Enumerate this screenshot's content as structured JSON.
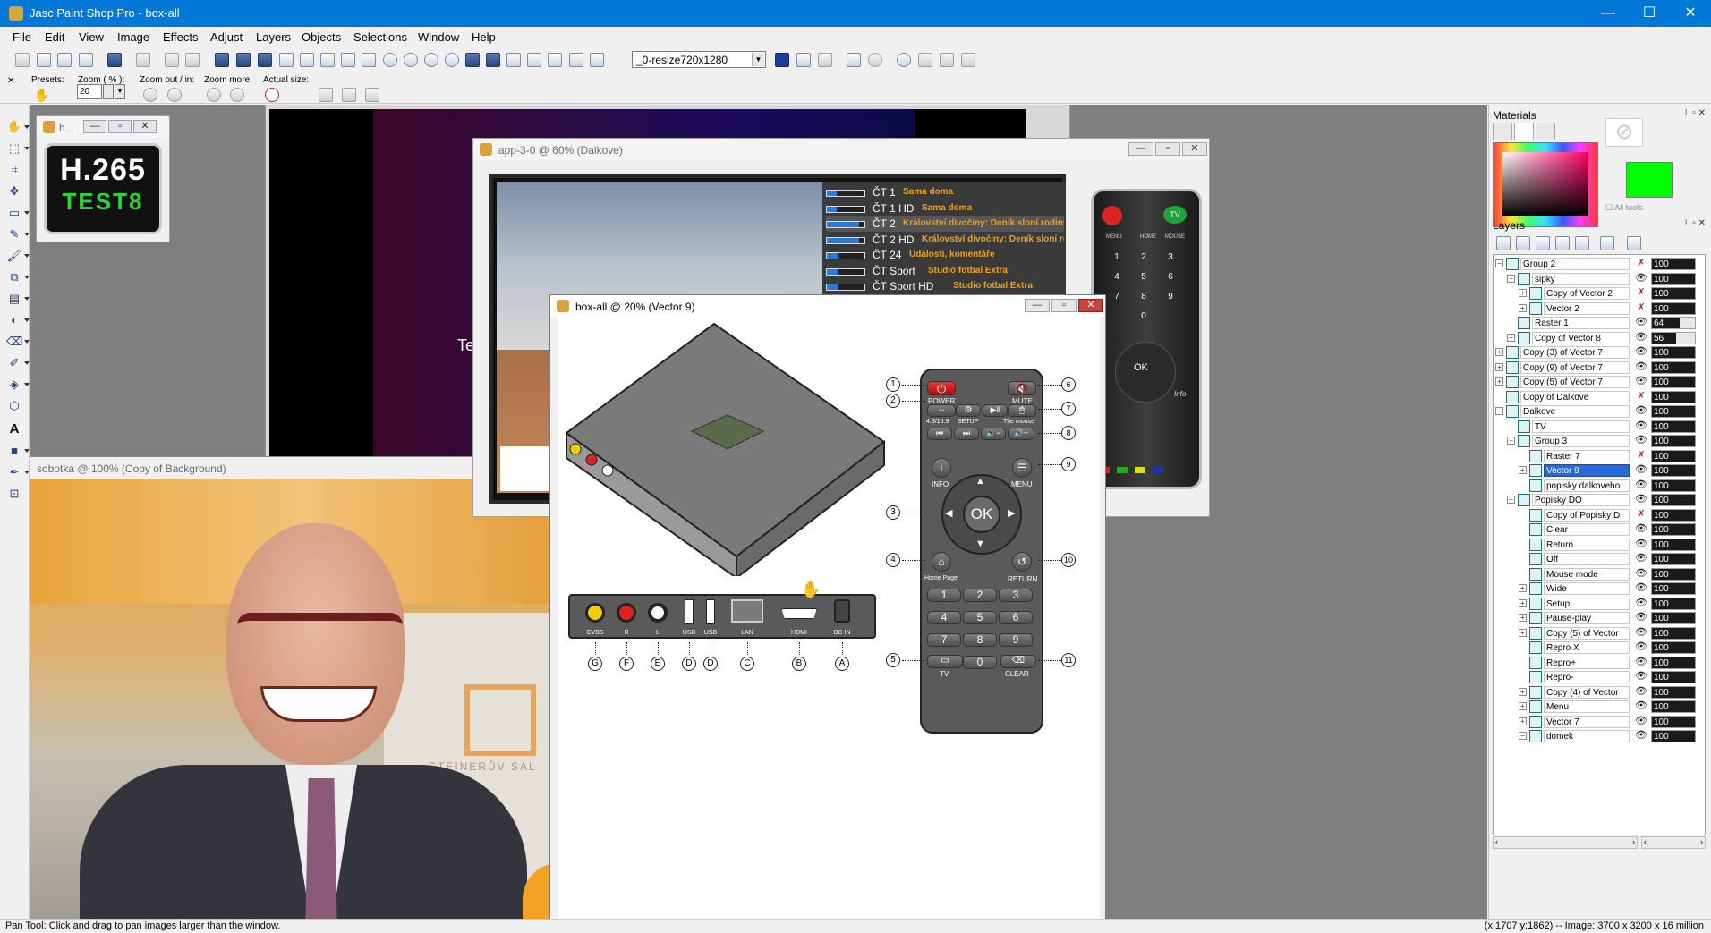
{
  "app": {
    "title": "Jasc Paint Shop Pro - box-all",
    "window_controls": {
      "minimize": "—",
      "maximize": "☐",
      "close": "✕"
    }
  },
  "menu": [
    "File",
    "Edit",
    "View",
    "Image",
    "Effects",
    "Adjust",
    "Layers",
    "Objects",
    "Selections",
    "Window",
    "Help"
  ],
  "toolbar": {
    "script_select": "_0-resize720x1280"
  },
  "tool_options": {
    "presets_label": "Presets:",
    "zoom_label": "Zoom ( % ):",
    "zoom_value": "20",
    "zoom_out_in_label": "Zoom out / in:",
    "zoom_more_label": "Zoom more:",
    "actual_size_label": "Actual size:"
  },
  "documents": {
    "h265": {
      "title": "h...",
      "logo_line1": "H.265",
      "logo_line2": "TEST8"
    },
    "background_doc": {
      "partial_text": "Te"
    },
    "sobotka": {
      "title": "sobotka @ 100% (Copy of Background)",
      "wall_text": "STEINERŮV SÁL"
    },
    "app3": {
      "title": "app-3-0 @  60% (Dalkove)",
      "channels": [
        {
          "name": "ČT 1",
          "show": "Sama doma",
          "progress": 0.25
        },
        {
          "name": "ČT 1 HD",
          "show": "Sama doma",
          "progress": 0.25
        },
        {
          "name": "ČT 2",
          "show": "Království divočiny: Deník sloní rodiny",
          "progress": 0.85
        },
        {
          "name": "ČT 2 HD",
          "show": "Království divočiny: Deník sloní rod",
          "progress": 0.85
        },
        {
          "name": "ČT 24",
          "show": "Události, komentáře",
          "progress": 0.3
        },
        {
          "name": "ČT Sport",
          "show": "Studio fotbal Extra",
          "progress": 0.3
        },
        {
          "name": "ČT Sport  HD",
          "show": "Studio fotbal Extra",
          "progress": 0.3
        }
      ],
      "remote": {
        "tv_label": "TV",
        "menu_label": "MENU",
        "home_label": "HOME",
        "mouse_label": "MOUSE",
        "ok_label": "OK",
        "keys": [
          "1",
          "2",
          "3",
          "4",
          "5",
          "6",
          "7",
          "8",
          "9",
          "0"
        ],
        "brand": "Info"
      }
    },
    "boxall": {
      "title": "box-all @  20% (Vector 9)",
      "remote": {
        "power_label": "POWER",
        "mute_label": "MUTE",
        "aspect_label": "4:3/16:9",
        "setup_label": "SETUP",
        "mouse_label": "The mouse",
        "info_label": "INFO",
        "menu_label": "MENU",
        "ok_label": "OK",
        "home_label": "Home Page",
        "return_label": "RETURN",
        "tv_label": "TV",
        "clear_label": "CLEAR",
        "keys": [
          "1",
          "2",
          "3",
          "4",
          "5",
          "6",
          "7",
          "8",
          "9",
          "0"
        ]
      },
      "callouts_left": [
        "1",
        "2",
        "3",
        "4",
        "5"
      ],
      "callouts_right": [
        "6",
        "7",
        "8",
        "9",
        "10",
        "11"
      ],
      "ports": [
        "CVBS",
        "R",
        "L",
        "USB",
        "USB",
        "LAN",
        "HDMI",
        "DC IN"
      ],
      "port_letters": [
        "G",
        "F",
        "E",
        "D",
        "D",
        "C",
        "B",
        "A"
      ]
    }
  },
  "materials": {
    "title": "Materials",
    "all_tools": "All tools",
    "foreground_color": "#00ff00"
  },
  "layers": {
    "title": "Layers",
    "rows": [
      {
        "name": "Group 2",
        "depth": 0,
        "expander": "−",
        "visible": false,
        "opacity": 100
      },
      {
        "name": "šipky",
        "depth": 1,
        "expander": "−",
        "visible": true,
        "opacity": 100
      },
      {
        "name": "Copy of Vector 2",
        "depth": 2,
        "expander": "+",
        "visible": false,
        "opacity": 100
      },
      {
        "name": "Vector 2",
        "depth": 2,
        "expander": "+",
        "visible": false,
        "opacity": 100
      },
      {
        "name": "Raster 1",
        "depth": 1,
        "expander": "",
        "visible": true,
        "opacity": 64
      },
      {
        "name": "Copy of Vector 8",
        "depth": 1,
        "expander": "+",
        "visible": true,
        "opacity": 56
      },
      {
        "name": "Copy (3) of Vector 7",
        "depth": 0,
        "expander": "+",
        "visible": true,
        "opacity": 100
      },
      {
        "name": "Copy (9) of Vector 7",
        "depth": 0,
        "expander": "+",
        "visible": true,
        "opacity": 100
      },
      {
        "name": "Copy (5) of Vector 7",
        "depth": 0,
        "expander": "+",
        "visible": true,
        "opacity": 100
      },
      {
        "name": "Copy of Dalkove",
        "depth": 0,
        "expander": "",
        "visible": false,
        "opacity": 100
      },
      {
        "name": "Dalkove",
        "depth": 0,
        "expander": "−",
        "visible": true,
        "opacity": 100
      },
      {
        "name": "TV",
        "depth": 1,
        "expander": "",
        "visible": true,
        "opacity": 100
      },
      {
        "name": "Group 3",
        "depth": 1,
        "expander": "−",
        "visible": true,
        "opacity": 100
      },
      {
        "name": "Raster 7",
        "depth": 2,
        "expander": "",
        "visible": false,
        "opacity": 100
      },
      {
        "name": "Vector 9",
        "depth": 2,
        "expander": "+",
        "visible": true,
        "opacity": 100,
        "selected": true
      },
      {
        "name": "popisky dalkoveho",
        "depth": 2,
        "expander": "",
        "visible": true,
        "opacity": 100
      },
      {
        "name": "Popisky DO",
        "depth": 1,
        "expander": "−",
        "visible": true,
        "opacity": 100
      },
      {
        "name": "Copy of Popisky D",
        "depth": 2,
        "expander": "",
        "visible": false,
        "opacity": 100
      },
      {
        "name": "Clear",
        "depth": 2,
        "expander": "",
        "visible": true,
        "opacity": 100
      },
      {
        "name": "Return",
        "depth": 2,
        "expander": "",
        "visible": true,
        "opacity": 100
      },
      {
        "name": "Off",
        "depth": 2,
        "expander": "",
        "visible": true,
        "opacity": 100
      },
      {
        "name": "Mouse mode",
        "depth": 2,
        "expander": "",
        "visible": true,
        "opacity": 100
      },
      {
        "name": "Wide",
        "depth": 2,
        "expander": "+",
        "visible": true,
        "opacity": 100
      },
      {
        "name": "Setup",
        "depth": 2,
        "expander": "+",
        "visible": true,
        "opacity": 100
      },
      {
        "name": "Pause-play",
        "depth": 2,
        "expander": "+",
        "visible": true,
        "opacity": 100
      },
      {
        "name": "Copy (5) of Vector",
        "depth": 2,
        "expander": "+",
        "visible": true,
        "opacity": 100
      },
      {
        "name": "Repro X",
        "depth": 2,
        "expander": "",
        "visible": true,
        "opacity": 100
      },
      {
        "name": "Repro+",
        "depth": 2,
        "expander": "",
        "visible": true,
        "opacity": 100
      },
      {
        "name": "Repro-",
        "depth": 2,
        "expander": "",
        "visible": true,
        "opacity": 100
      },
      {
        "name": "Copy (4) of Vector",
        "depth": 2,
        "expander": "+",
        "visible": true,
        "opacity": 100
      },
      {
        "name": "Menu",
        "depth": 2,
        "expander": "+",
        "visible": true,
        "opacity": 100
      },
      {
        "name": "Vector 7",
        "depth": 2,
        "expander": "+",
        "visible": true,
        "opacity": 100
      },
      {
        "name": "domek",
        "depth": 2,
        "expander": "−",
        "visible": true,
        "opacity": 100
      }
    ]
  },
  "status": {
    "left": "Pan Tool: Click and drag to pan images larger than the window.",
    "right": "(x:1707 y:1862) -- Image:  3700 x 3200 x 16 million"
  }
}
